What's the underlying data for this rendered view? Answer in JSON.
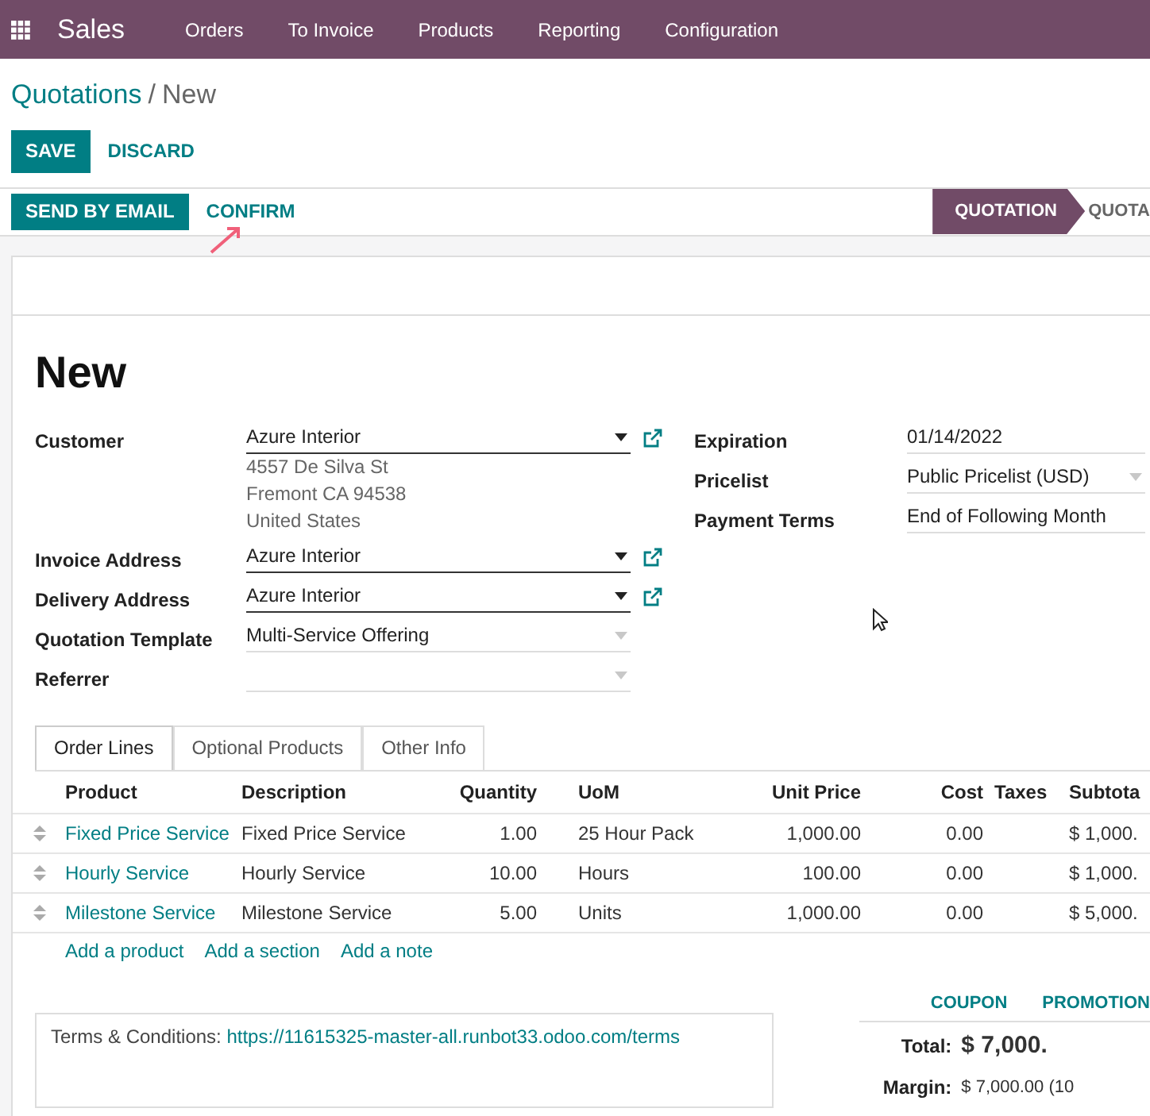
{
  "navbar": {
    "app": "Sales",
    "menu": [
      "Orders",
      "To Invoice",
      "Products",
      "Reporting",
      "Configuration"
    ]
  },
  "breadcrumb": {
    "parent": "Quotations",
    "separator": "/",
    "current": "New"
  },
  "actions": [
    {
      "label": "SAVE",
      "kind": "primary"
    },
    {
      "label": "DISCARD",
      "kind": "link"
    }
  ],
  "header_buttons": [
    {
      "label": "SEND BY EMAIL",
      "kind": "primary"
    },
    {
      "label": "CONFIRM",
      "kind": "link"
    }
  ],
  "status_stages": [
    {
      "label": "QUOTATION",
      "selected": true
    },
    {
      "label": "QUOTA",
      "selected": false
    }
  ],
  "record_title": "New",
  "left_fields": [
    {
      "label": "Customer",
      "value": "Azure Interior",
      "kind": "many2one",
      "address": [
        "4557 De Silva St",
        "Fremont CA 94538",
        "United States"
      ]
    },
    {
      "label": "Invoice Address",
      "value": "Azure Interior",
      "kind": "many2one"
    },
    {
      "label": "Delivery Address",
      "value": "Azure Interior",
      "kind": "many2one"
    },
    {
      "label": "Quotation Template",
      "value": "Multi-Service Offering",
      "kind": "select"
    },
    {
      "label": "Referrer",
      "kind": "select"
    }
  ],
  "right_fields": [
    {
      "label": "Expiration",
      "value": "01/14/2022",
      "kind": "text"
    },
    {
      "label": "Pricelist",
      "value": "Public Pricelist (USD)",
      "kind": "select"
    },
    {
      "label": "Payment Terms",
      "value": "End of Following Month",
      "kind": "text"
    }
  ],
  "tabs": [
    {
      "label": "Order Lines",
      "selected": true
    },
    {
      "label": "Optional Products",
      "selected": false
    },
    {
      "label": "Other Info",
      "selected": false
    }
  ],
  "order_lines": {
    "columns": [
      "Product",
      "Description",
      "Quantity",
      "UoM",
      "Unit Price",
      "Cost",
      "Taxes",
      "Subtota"
    ],
    "rows": [
      {
        "product": "Fixed Price Service",
        "description": "Fixed Price Service",
        "quantity": "1.00",
        "uom": "25 Hour Pack",
        "unit_price": "1,000.00",
        "cost": "0.00",
        "subtotal": "$ 1,000."
      },
      {
        "product": "Hourly Service",
        "description": "Hourly Service",
        "quantity": "10.00",
        "uom": "Hours",
        "unit_price": "100.00",
        "cost": "0.00",
        "subtotal": "$ 1,000."
      },
      {
        "product": "Milestone Service",
        "description": "Milestone Service",
        "quantity": "5.00",
        "uom": "Units",
        "unit_price": "1,000.00",
        "cost": "0.00",
        "subtotal": "$ 5,000."
      }
    ],
    "add_links": [
      "Add a product",
      "Add a section",
      "Add a note"
    ]
  },
  "promo_buttons": [
    "COUPON",
    "PROMOTION"
  ],
  "terms": {
    "label": "Terms & Conditions:",
    "link": "https://11615325-master-all.runbot33.odoo.com/terms"
  },
  "totals": [
    {
      "label": "Total:",
      "value": "$ 7,000.",
      "kind": "total"
    },
    {
      "label": "Margin:",
      "value": "$ 7,000.00 (10",
      "kind": "margin"
    }
  ]
}
